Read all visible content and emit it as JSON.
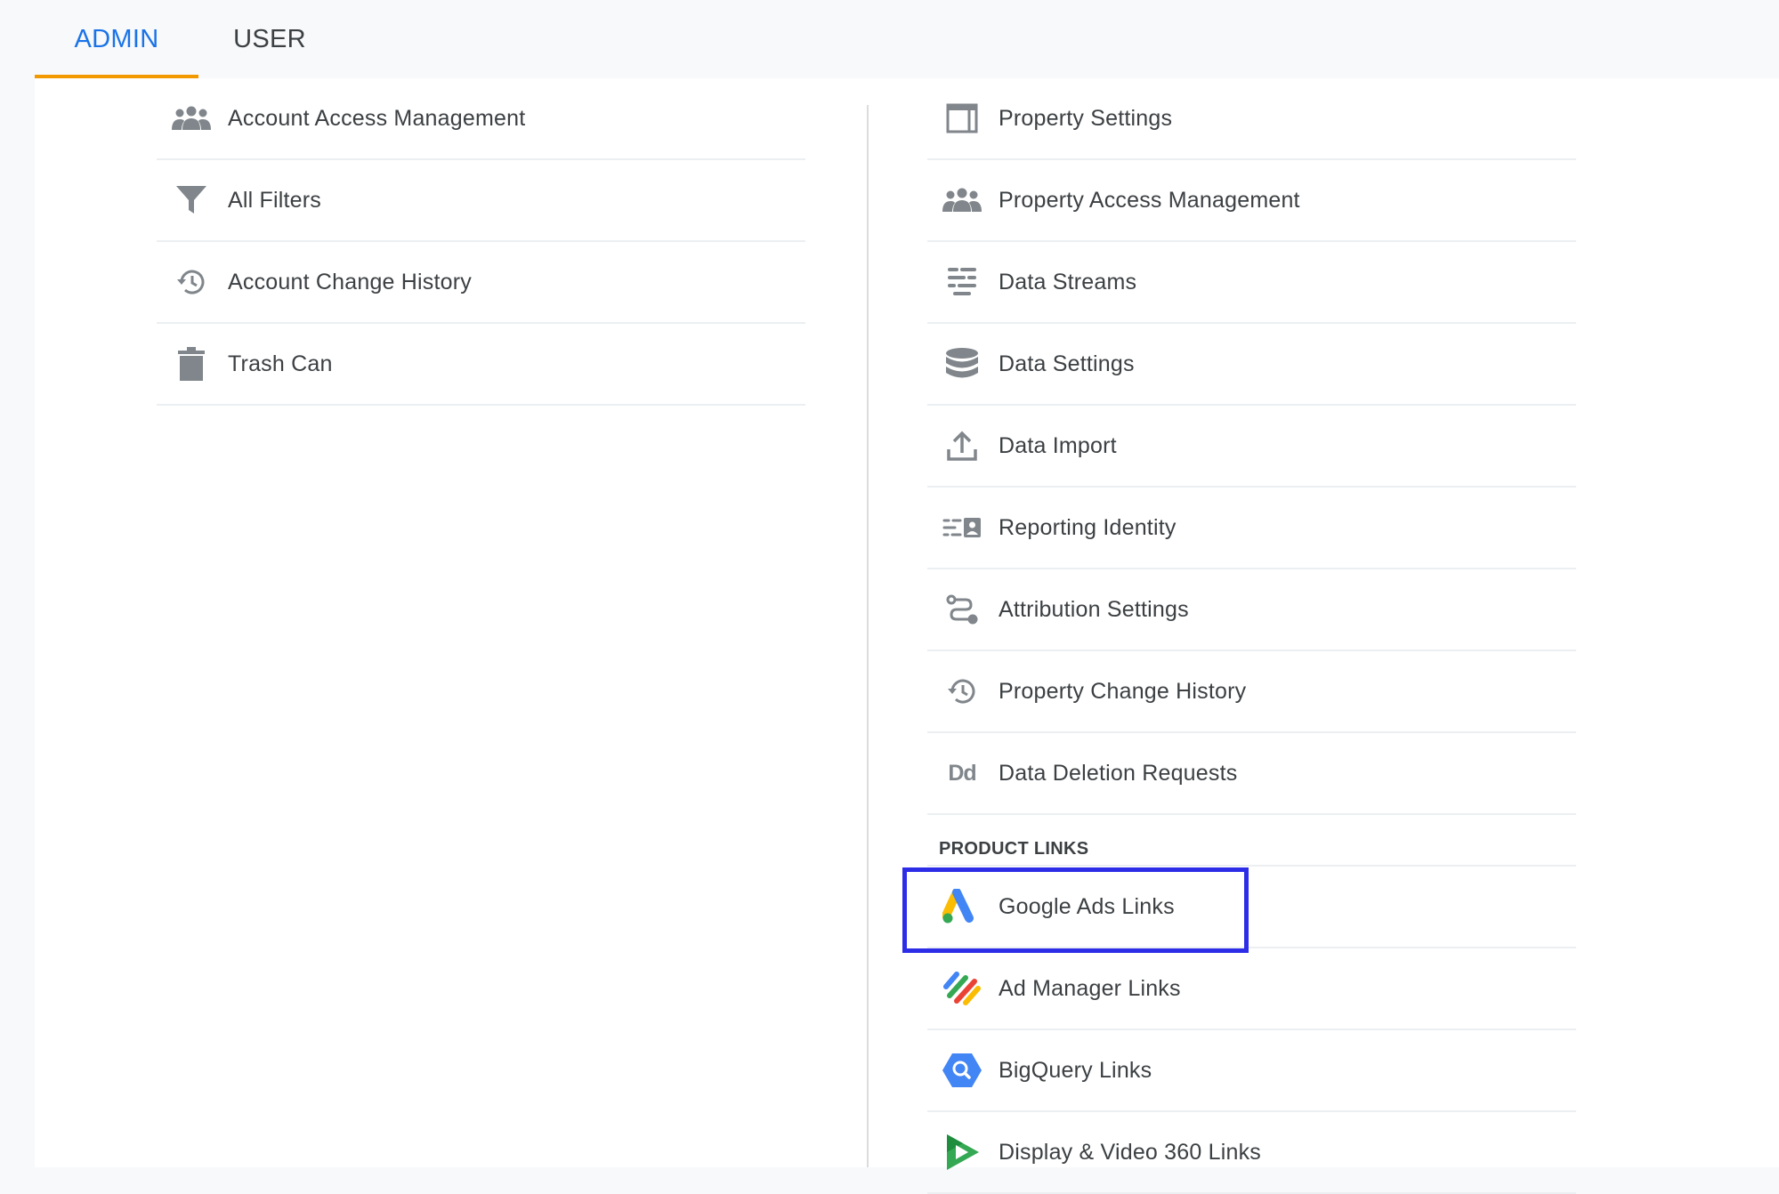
{
  "tabs": [
    {
      "label": "ADMIN",
      "active": true
    },
    {
      "label": "USER",
      "active": false
    }
  ],
  "account": {
    "items": [
      {
        "label": "Account Access Management",
        "icon": "people-icon"
      },
      {
        "label": "All Filters",
        "icon": "filter-icon"
      },
      {
        "label": "Account Change History",
        "icon": "history-icon"
      },
      {
        "label": "Trash Can",
        "icon": "trash-icon"
      }
    ]
  },
  "property": {
    "items": [
      {
        "label": "Property Settings",
        "icon": "property-settings-icon"
      },
      {
        "label": "Property Access Management",
        "icon": "people-icon"
      },
      {
        "label": "Data Streams",
        "icon": "data-streams-icon"
      },
      {
        "label": "Data Settings",
        "icon": "database-icon"
      },
      {
        "label": "Data Import",
        "icon": "upload-icon"
      },
      {
        "label": "Reporting Identity",
        "icon": "reporting-identity-icon"
      },
      {
        "label": "Attribution Settings",
        "icon": "attribution-icon"
      },
      {
        "label": "Property Change History",
        "icon": "history-icon"
      },
      {
        "label": "Data Deletion Requests",
        "icon": "data-deletion-icon",
        "icon_text": "Dd"
      }
    ],
    "product_links_header": "PRODUCT LINKS",
    "product_links": [
      {
        "label": "Google Ads Links",
        "icon": "google-ads-icon",
        "highlighted": true
      },
      {
        "label": "Ad Manager Links",
        "icon": "ad-manager-icon"
      },
      {
        "label": "BigQuery Links",
        "icon": "bigquery-icon"
      },
      {
        "label": "Display & Video 360 Links",
        "icon": "display-video-360-icon"
      }
    ]
  },
  "colors": {
    "active_tab": "#1a73e8",
    "tab_indicator": "#f29900",
    "highlight_box": "#2d2de8",
    "icon_gray": "#80868b"
  }
}
